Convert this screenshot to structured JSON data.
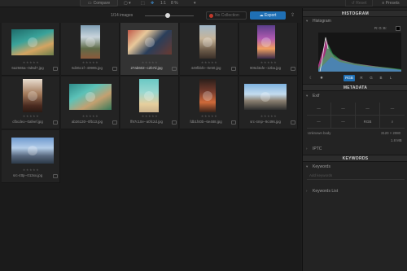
{
  "topbar": {
    "compare_label": "Compare",
    "zoom_ratio": "1:1",
    "zoom_percent": "8 %",
    "reset_label": "Reset",
    "presets_label": "Presets"
  },
  "gridbar": {
    "image_count": "1/14 images",
    "zoom_level": 0.47,
    "no_collection_label": "No Collection",
    "export_label": "Export"
  },
  "images": [
    {
      "filename": "6a2565a--0d6d7.jpg",
      "selected": false
    },
    {
      "filename": "6d36c1f--49995.jpg",
      "selected": false
    },
    {
      "filename": "27ab602--c2b7d.jpg",
      "selected": true
    },
    {
      "filename": "449fbbfe--0e50.jpg",
      "selected": false
    },
    {
      "filename": "906d3afe--12ba.jpg",
      "selected": false
    },
    {
      "filename": "cfbcdeo--0afeef.jpg",
      "selected": false
    },
    {
      "filename": "ab26130--0fb13.jpg",
      "selected": false
    },
    {
      "filename": "ff97c10e--a0fc2d.jpg",
      "selected": false
    },
    {
      "filename": "fdb1f40b--6e488.jpg",
      "selected": false
    },
    {
      "filename": "src-4mp--9c496.jpg",
      "selected": false
    },
    {
      "filename": "src-4ttp--013xx.jpg",
      "selected": false
    }
  ],
  "panel": {
    "histogram": {
      "title": "HISTOGRAM",
      "sub_label": "Histogram",
      "rgb_readout": "R: G: B:",
      "buttons": [
        "RGB",
        "R",
        "G",
        "B",
        "L"
      ],
      "active_button": "RGB"
    },
    "metadata": {
      "title": "METADATA",
      "exif_label": "Exif",
      "exif_values": [
        "—",
        "—",
        "—",
        "—",
        "—",
        "—",
        "RGB",
        ""
      ],
      "lens_label": "Unknown body",
      "resolution": "3120 × 2080",
      "filesize": "1.8 MB",
      "iptc_label": "IPTC"
    },
    "keywords": {
      "title": "KEYWORDS",
      "keywords_label": "Keywords",
      "input_placeholder": "Add keywords",
      "list_label": "Keywords List"
    }
  },
  "colors": {
    "accent": "#1f6fb4",
    "background": "#1d1d1d",
    "panel": "#232323",
    "selected_cell": "#333333"
  }
}
